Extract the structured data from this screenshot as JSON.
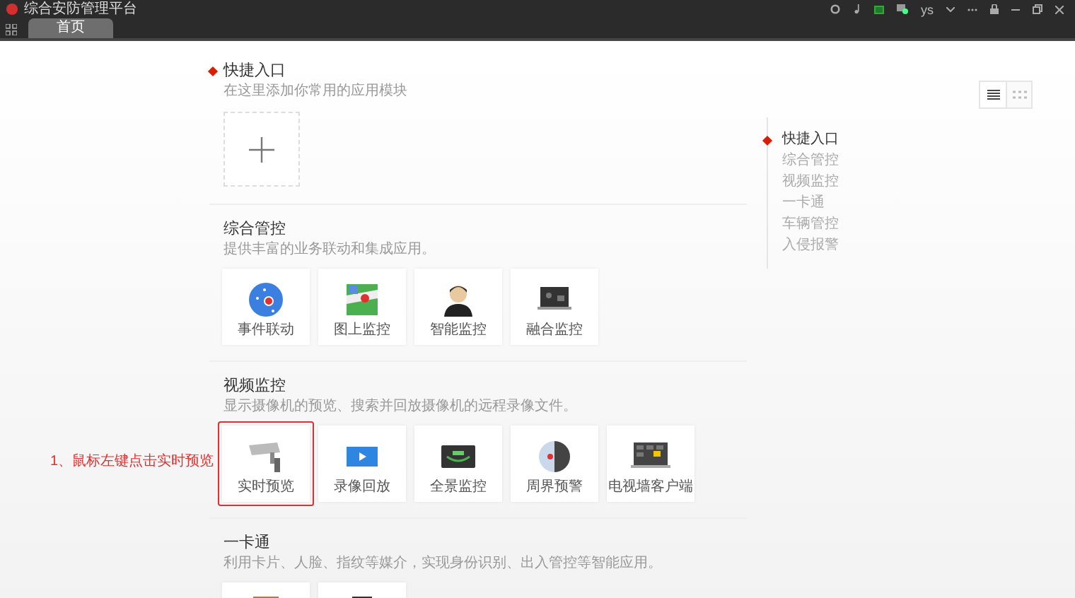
{
  "window": {
    "title": "综合安防管理平台",
    "user": "ys"
  },
  "tabs": [
    {
      "label": "首页",
      "selected": true
    }
  ],
  "view_toggle": [
    {
      "kind": "list",
      "selected": true
    },
    {
      "kind": "grid",
      "selected": false
    }
  ],
  "sections": [
    {
      "title": "快捷入口",
      "description": "在这里添加你常用的应用模块",
      "active": true,
      "apps": [
        {
          "kind": "add"
        }
      ]
    },
    {
      "title": "综合管控",
      "description": "提供丰富的业务联动和集成应用。",
      "active": false,
      "apps": [
        {
          "kind": "event",
          "label": "事件联动",
          "highlighted": false
        },
        {
          "kind": "map",
          "label": "图上监控",
          "highlighted": false
        },
        {
          "kind": "person",
          "label": "智能监控",
          "highlighted": false
        },
        {
          "kind": "monitor",
          "label": "融合监控",
          "highlighted": false
        }
      ]
    },
    {
      "title": "视频监控",
      "description": "显示摄像机的预览、搜索并回放摄像机的远程录像文件。",
      "active": false,
      "apps": [
        {
          "kind": "camera",
          "label": "实时预览",
          "highlighted": true
        },
        {
          "kind": "playback",
          "label": "录像回放",
          "highlighted": false
        },
        {
          "kind": "panorama",
          "label": "全景监控",
          "highlighted": false
        },
        {
          "kind": "radar",
          "label": "周界预警",
          "highlighted": false
        },
        {
          "kind": "tvwall",
          "label": "电视墙客户端",
          "highlighted": false
        }
      ]
    },
    {
      "title": "一卡通",
      "description": "利用卡片、人脸、指纹等媒介，实现身份识别、出入管控等智能应用。",
      "active": false,
      "apps": [
        {
          "kind": "door",
          "highlighted": false
        },
        {
          "kind": "lamp",
          "highlighted": false
        }
      ]
    }
  ],
  "nav": [
    {
      "label": "快捷入口",
      "selected": true
    },
    {
      "label": "综合管控",
      "selected": false
    },
    {
      "label": "视频监控",
      "selected": false
    },
    {
      "label": "一卡通",
      "selected": false
    },
    {
      "label": "车辆管控",
      "selected": false
    },
    {
      "label": "入侵报警",
      "selected": false
    }
  ],
  "annotation": "1、鼠标左键点击实时预览"
}
